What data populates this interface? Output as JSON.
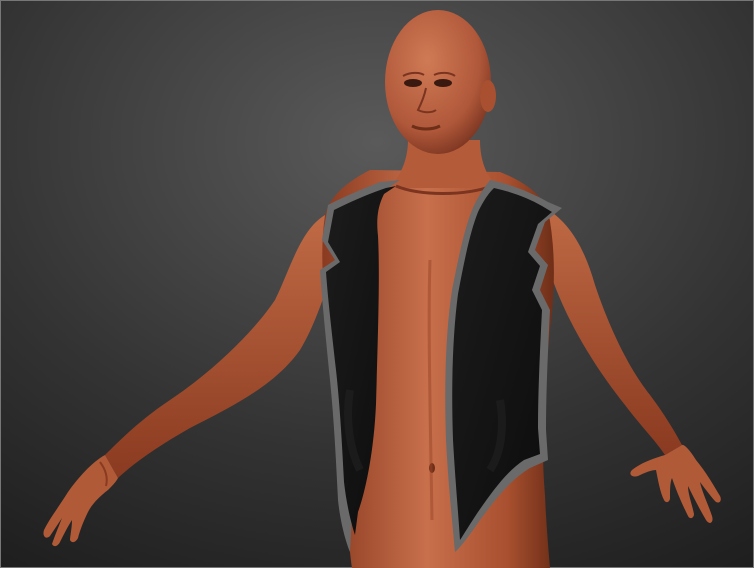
{
  "scene": {
    "subject": "mannequin-figure",
    "garment": "black-open-vest",
    "colors": {
      "background_top": "#5a5a5a",
      "background_bottom": "#1e1e1e",
      "skin_light": "#c8704c",
      "skin_mid": "#a8502f",
      "skin_dark": "#6e2e18",
      "vest_fabric": "#141414",
      "vest_trim": "#6a6a6a",
      "frame_border": "#777777"
    }
  }
}
